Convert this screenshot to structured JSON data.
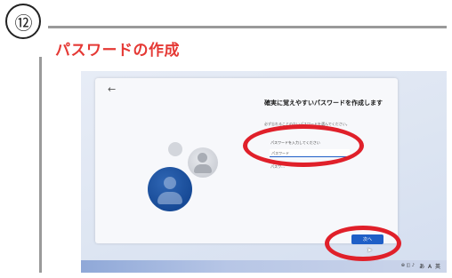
{
  "step": {
    "number": "⑫"
  },
  "section": {
    "title": "パスワードの作成"
  },
  "window": {
    "back_icon": "back-arrow-icon",
    "title": "確実に覚えやすいパスワードを作成します",
    "subtitle": "必ず忘れることのないパスワードを選んでください。",
    "password_label": "パスワードを入力してください",
    "password_placeholder": "パスワード",
    "password_value": "",
    "show_password_caption": "パスワ…",
    "next_button_label": "次へ"
  },
  "taskbar": {
    "tray_icons_text": "⊕ ◫ ♪",
    "ime_indicator": "あ A 英"
  },
  "annotations": {
    "highlight_color": "#e0202a",
    "title_color": "#e53935",
    "accent_color": "#1f5fc7"
  }
}
